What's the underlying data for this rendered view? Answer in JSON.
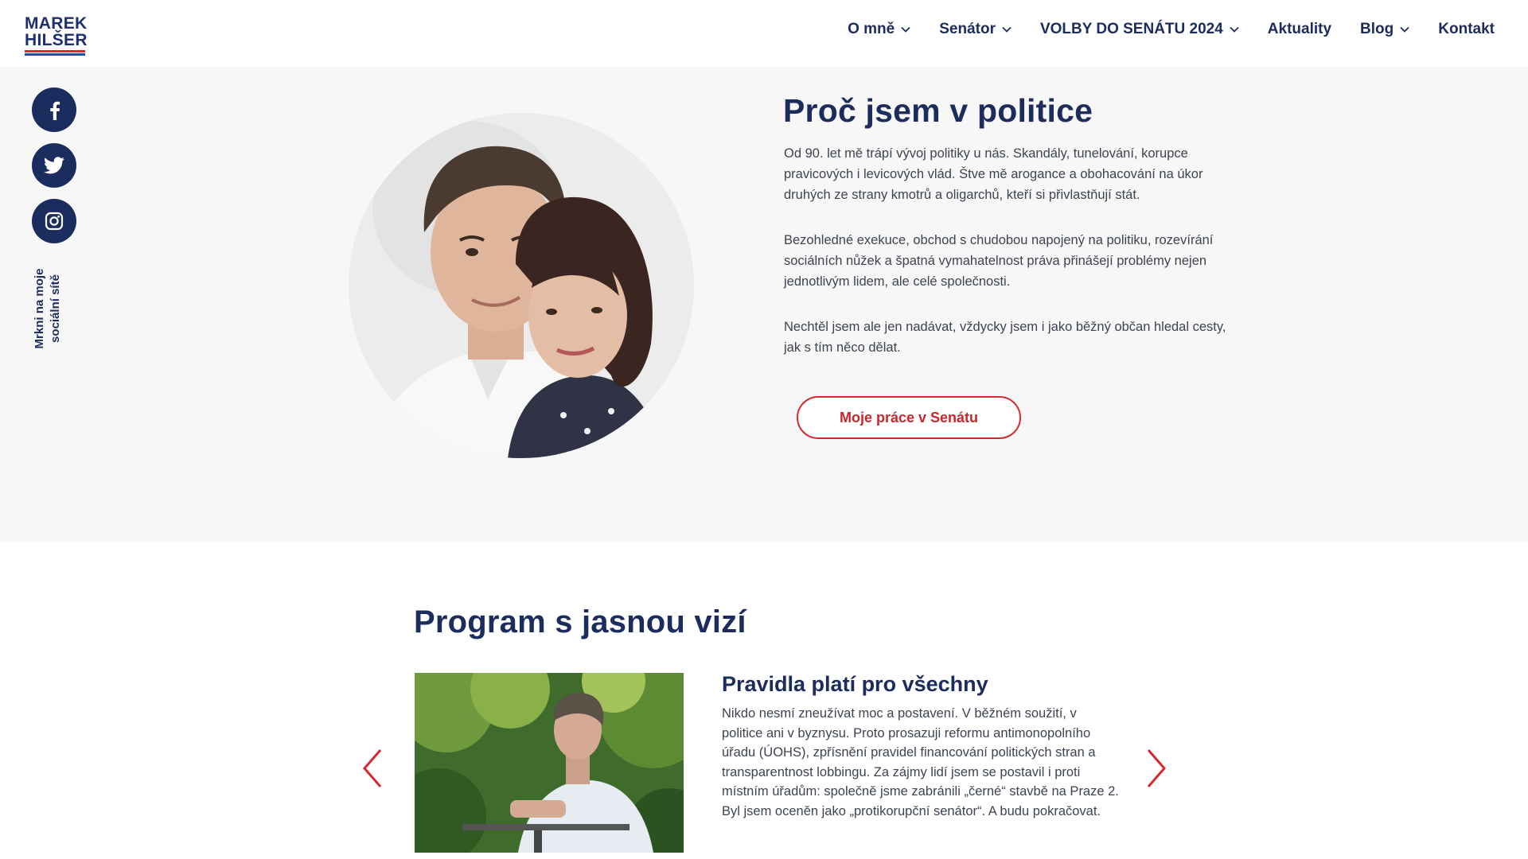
{
  "header": {
    "logo_line1": "MAREK",
    "logo_line2": "HILŠER",
    "nav": [
      {
        "label": "O mně",
        "dropdown": true
      },
      {
        "label": "Senátor",
        "dropdown": true
      },
      {
        "label": "VOLBY DO SENÁTU 2024",
        "dropdown": true
      },
      {
        "label": "Aktuality",
        "dropdown": false
      },
      {
        "label": "Blog",
        "dropdown": true
      },
      {
        "label": "Kontakt",
        "dropdown": false
      }
    ]
  },
  "social": {
    "icons": [
      "facebook-icon",
      "twitter-icon",
      "instagram-icon"
    ],
    "label_line1": "Mrkni na moje",
    "label_line2": "sociální sítě"
  },
  "hero": {
    "title": "Proč jsem v politice",
    "paragraphs": [
      "Od 90. let mě trápí vývoj politiky u nás. Skandály, tunelování, korupce pravicových i levicových vlád. Štve mě arogance a obohacování na úkor druhých ze strany kmotrů a oligarchů, kteří si přivlastňují stát.",
      "Bezohledné exekuce, obchod s chudobou napojený na politiku, rozevírání sociálních nůžek a špatná vymahatelnost práva přinášejí problémy nejen jednotlivým lidem, ale celé společnosti.",
      "Nechtěl jsem ale jen nadávat, vždycky jsem i jako běžný občan hledal cesty, jak s tím něco dělat."
    ],
    "cta_label": "Moje práce v Senátu"
  },
  "program": {
    "title": "Program s jasnou vizí",
    "slide_heading": "Pravidla platí pro všechny",
    "slide_text": "Nikdo nesmí zneužívat moc a postavení. V běžném soužití, v politice ani v byznysu. Proto prosazuji reformu antimonopolního úřadu (ÚOHS), zpřísnění pravidel financování politických stran a transparentnost lobbingu. Za zájmy lidí jsem se postavil i proti místním úřadům: společně jsme zabránili „černé“ stavbě na Praze 2. Byl jsem oceněn jako „protikorupční senátor“. A budu pokračovat."
  },
  "colors": {
    "navy": "#1c2c5c",
    "red": "#d42a2f",
    "hero_bg": "#f7f7f7"
  }
}
